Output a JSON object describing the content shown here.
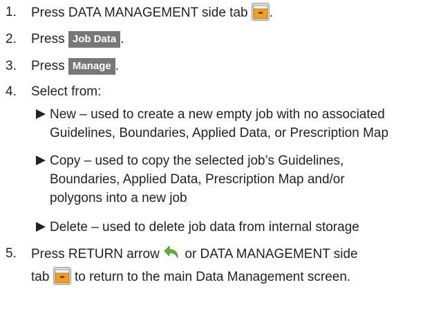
{
  "steps": [
    {
      "num": "1.",
      "before": "Press DATA MANAGEMENT side tab",
      "icon": "data-management-tab-icon",
      "after": "."
    },
    {
      "num": "2.",
      "before": "Press",
      "button": "Job Data",
      "after": "."
    },
    {
      "num": "3.",
      "before": "Press",
      "button": "Manage",
      "after": "."
    },
    {
      "num": "4.",
      "text": "Select from:"
    },
    {
      "num": "5.",
      "line1_before": "Press RETURN arrow",
      "return_icon": "return-arrow-icon",
      "line1_after": "or DATA MANAGEMENT side",
      "line2_before": "tab",
      "line2_icon": "data-management-tab-icon",
      "line2_after": "to return to the main Data Management screen."
    }
  ],
  "options": [
    {
      "lines": [
        "New – used to create a new empty job with no associated",
        "Guidelines, Boundaries, Applied Data, or Prescription Map"
      ]
    },
    {
      "lines": [
        "Copy – used to copy the selected job’s Guidelines,",
        "Boundaries, Applied Data, Prescription Map and/or",
        "polygons into a new job"
      ]
    },
    {
      "lines": [
        "Delete – used to delete job data from internal storage"
      ]
    }
  ],
  "colors": {
    "text": "#222222",
    "button_bg": "#777777",
    "button_text": "#ffffff",
    "folder_orange": "#f0a020",
    "return_green": "#5bb531"
  }
}
